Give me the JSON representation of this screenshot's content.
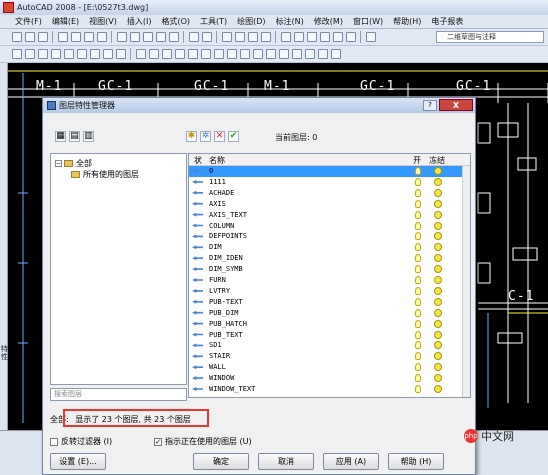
{
  "window": {
    "title": "AutoCAD 2008 - [E:\\0527t3.dwg]"
  },
  "menu": [
    "文件(F)",
    "编辑(E)",
    "视图(V)",
    "插入(I)",
    "格式(O)",
    "工具(T)",
    "绘图(D)",
    "标注(N)",
    "修改(M)",
    "窗口(W)",
    "帮助(H)",
    "电子报表"
  ],
  "toolbar": {
    "workspace": "二维草图与注释"
  },
  "side_label": "特性",
  "drawing_labels": [
    {
      "text": "M-1"
    },
    {
      "text": "GC-1"
    },
    {
      "text": "GC-1"
    },
    {
      "text": "M-1"
    },
    {
      "text": "GC-1"
    },
    {
      "text": "GC-1"
    },
    {
      "text": "C-1"
    }
  ],
  "dialog": {
    "title": "图层特性管理器",
    "help": "?",
    "close": "X",
    "current_layer": "当前图层: 0",
    "tree": {
      "root": "全部",
      "child": "所有使用的图层"
    },
    "search_placeholder": "搜索图层",
    "columns": {
      "status": "状",
      "name": "名称",
      "on": "开",
      "freeze": "冻结"
    },
    "layers": [
      "0",
      "1111",
      "ACHADE",
      "AXIS",
      "AXIS_TEXT",
      "COLUMN",
      "DEFPOINTS",
      "DIM",
      "DIM_IDEN",
      "DIM_SYMB",
      "FURN",
      "LVTRY",
      "PUB-TEXT",
      "PUB_DIM",
      "PUB_HATCH",
      "PUB_TEXT",
      "SD1",
      "STAIR",
      "WALL",
      "WINDOW",
      "WINDOW_TEXT"
    ],
    "status_prefix": "全部:",
    "status_text": "显示了 23 个图层, 共 23 个图层",
    "invert_filter": "反转过滤器 (I)",
    "indicate_used": "指示正在使用的图层 (U)",
    "buttons": {
      "settings": "设置 (E)...",
      "ok": "确定",
      "cancel": "取消",
      "apply": "应用 (A)",
      "help": "帮助 (H)"
    }
  },
  "watermark": {
    "logo": "php",
    "text": "中文网"
  }
}
